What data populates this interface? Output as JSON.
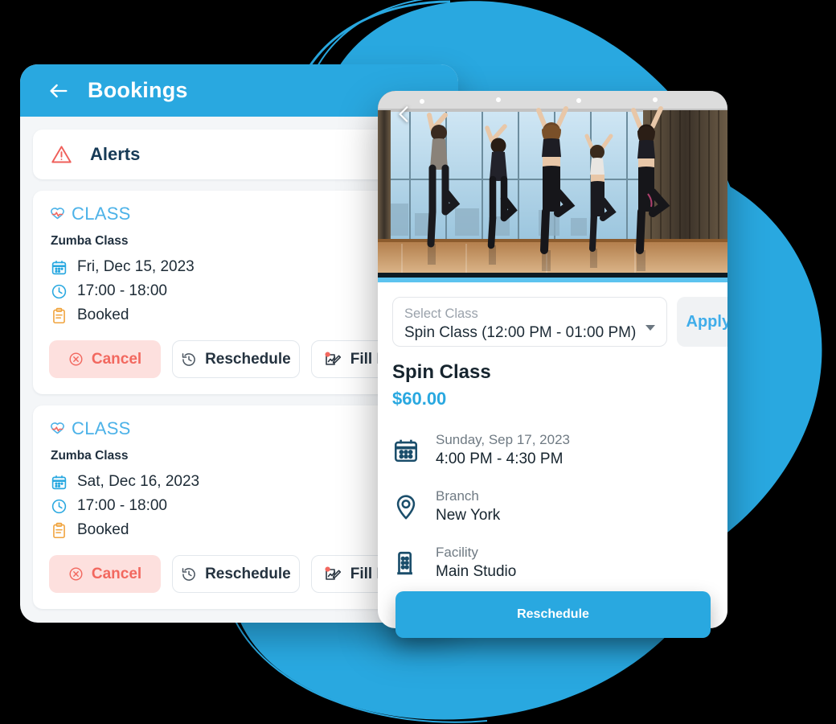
{
  "theme": {
    "brand_blue": "#29a8e0",
    "light_blue": "#4cb2e8",
    "danger_red": "#f2685f",
    "dark_navy": "#16242e",
    "muted_gray": "#6f7a83",
    "card_bg": "#ffffff",
    "page_bg": "#f4f6f8"
  },
  "bookings_panel": {
    "back_icon": "arrow-left-icon",
    "title": "Bookings",
    "alerts": {
      "icon": "warning-triangle-icon",
      "label": "Alerts"
    },
    "cards": [
      {
        "tag_icon": "heart-pulse-icon",
        "tag": "CLASS",
        "name": "Zumba Class",
        "date_icon": "calendar-icon",
        "date": "Fri, Dec 15, 2023",
        "time_icon": "clock-icon",
        "time": "17:00 - 18:00",
        "status_icon": "clipboard-icon",
        "status": "Booked",
        "actions": [
          {
            "icon": "cancel-circle-icon",
            "label": "Cancel"
          },
          {
            "icon": "history-icon",
            "label": "Reschedule"
          },
          {
            "icon": "form-pen-icon",
            "label": "Fill Form"
          }
        ]
      },
      {
        "tag_icon": "heart-pulse-icon",
        "tag": "CLASS",
        "name": "Zumba Class",
        "date_icon": "calendar-icon",
        "date": "Sat, Dec 16, 2023",
        "time_icon": "clock-icon",
        "time": "17:00 - 18:00",
        "status_icon": "clipboard-icon",
        "status": "Booked",
        "actions": [
          {
            "icon": "cancel-circle-icon",
            "label": "Cancel"
          },
          {
            "icon": "history-icon",
            "label": "Reschedule"
          },
          {
            "icon": "form-pen-icon",
            "label": "Fill Form"
          }
        ]
      }
    ]
  },
  "detail_panel": {
    "back_icon": "chevron-left-icon",
    "hero_alt": "group-fitness-class-photo",
    "select": {
      "placeholder": "Select Class",
      "value": "Spin Class (12:00 PM - 01:00 PM)",
      "caret_icon": "chevron-down-icon"
    },
    "apply_label": "Apply",
    "class_title": "Spin Class",
    "price": "$60.00",
    "details": [
      {
        "icon": "calendar-icon",
        "label": "Sunday, Sep 17, 2023",
        "value": "4:00 PM - 4:30 PM"
      },
      {
        "icon": "location-pin-icon",
        "label": "Branch",
        "value": "New York"
      },
      {
        "icon": "building-icon",
        "label": "Facility",
        "value": "Main Studio"
      }
    ],
    "cta_label": "Reschedule"
  }
}
